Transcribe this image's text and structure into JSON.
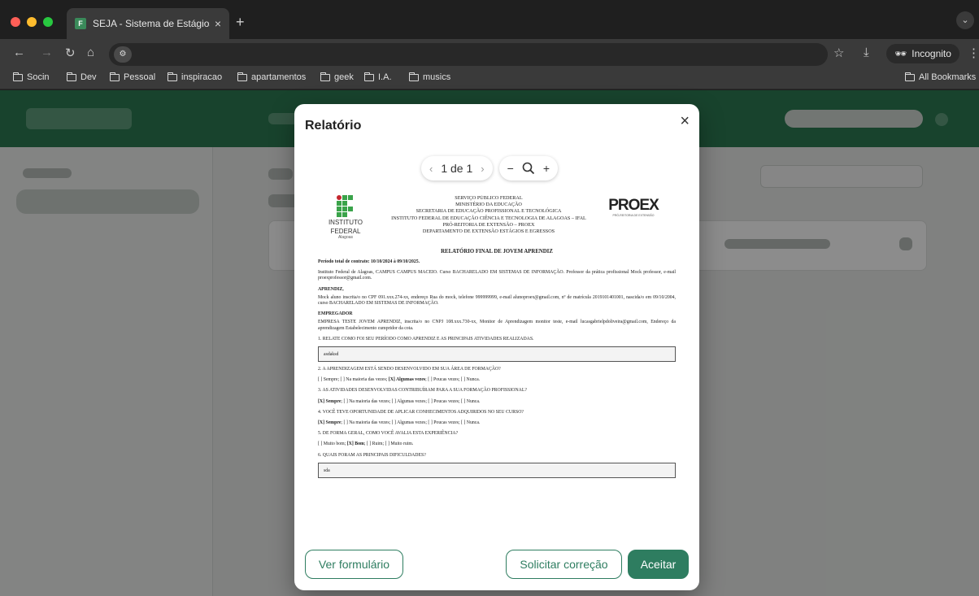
{
  "browser": {
    "tab_title": "SEJA - Sistema de Estágios e",
    "tab_favicon": "F",
    "new_tab": "+",
    "incognito_label": "Incognito",
    "bookmarks": [
      "Socin",
      "Dev",
      "Pessoal",
      "inspiracao",
      "apartamentos",
      "geek",
      "I.A.",
      "musics"
    ],
    "all_bookmarks": "All Bookmarks"
  },
  "modal": {
    "title": "Relatório",
    "close": "×",
    "pager": {
      "prev": "‹",
      "current": "1 de 1",
      "next": "›"
    },
    "zoom": {
      "minus": "−",
      "icon": "magnifier-icon",
      "plus": "+"
    },
    "buttons": {
      "form": "Ver formulário",
      "correction": "Solicitar correção",
      "accept": "Aceitar"
    }
  },
  "document": {
    "header_lines": [
      "SERVIÇO PÚBLICO FEDERAL",
      "MINISTÉRIO DA EDUCAÇÃO",
      "SECRETARIA DE EDUCAÇÃO PROFISSIONAL E TECNOLÓGICA",
      "INSTITUTO FEDERAL DE EDUCAÇÃO CIÊNCIA E TECNOLOGIA DE ALAGOAS – IFAL",
      "PRÓ-REITORIA DE EXTENSÃO – PROEX",
      "DEPARTAMENTO DE EXTENSÃO ESTÁGIOS E EGRESSOS"
    ],
    "if_logo": {
      "line1": "INSTITUTO",
      "line2": "FEDERAL",
      "line3": "Alagoas"
    },
    "proex_logo": {
      "text": "PROEX",
      "tagline": "PRÓ-REITORIA DE EXTENSÃO"
    },
    "title": "RELATÓRIO FINAL DE JOVEM APRENDIZ",
    "period": "Período total de contrato: 10/10/2024 à 09/10/2025.",
    "institution": "Instituto Federal de Alagoas, CAMPUS CAMPUS MACEIO. Curso BACHARELADO EM SISTEMAS DE INFORMAÇÃO. Professor da prática profissional Mock professor, e-mail proexprofessor@gmail.com.",
    "aprendiz_label": "APRENDIZ,",
    "aprendiz_text": "Mock aluno inscrita/o no CPF 091.xxx.274-xx, endereço Rua do mock, telefone 999999999, e-mail alunoproex@gmail.com, nº de matrícula 2019101401001, nascida/o em 09/10/2004, curso BACHARELADO EM SISTEMAS DE INFORMAÇÃO.",
    "empregador_label": "EMPREGADOR",
    "empregador_text": "EMPRESA TESTE JOVEM APRENDIZ, inscrita/o no CNPJ 108.xxx.730-xx, Monitor de Aprendizagem monitor teste, e-mail lucasgabrielpdoliveira@gmail.com, Endereço da aprendizagem Estabelecimento cumpridor da cota.",
    "q1": "1. RELATE COMO FOI SEU PERÍODO COMO APRENDIZ E AS PRINCIPAIS ATIVIDADES REALIZADAS.",
    "a1": "asdaksd",
    "q2": "2. A APRENDIZAGEM ESTÁ SENDO DESENVOLVIDO EM SUA ÁREA DE FORMAÇÃO?",
    "a2_pre": "[ ] Sempre; [ ] Na maioria das vezes; ",
    "a2_sel": "[X] Algumas vezes",
    "a2_post": "; [ ] Poucas vezes; [ ] Nunca.",
    "q3": "3. AS ATIVIDADES DESENVOLVIDAS CONTRIBUÍRAM PARA A SUA FORMAÇÃO PROFISSIONAL?",
    "a3_sel": "[X] Sempre",
    "a3_post": "; [ ] Na maioria das vezes; [ ] Algumas vezes; [ ] Poucas vezes; [ ] Nunca.",
    "q4": "4. VOCÊ TEVE OPORTUNIDADE DE APLICAR CONHECIMENTOS ADQUIRIDOS NO SEU CURSO?",
    "a4_sel": "[X] Sempre",
    "a4_post": "; [ ] Na maioria das vezes; [ ] Algumas vezes; [ ] Poucas vezes; [ ] Nunca.",
    "q5": "5. DE FORMA GERAL, COMO VOCÊ AVALIA ESTA EXPERIÊNCIA?",
    "a5_pre": "[ ] Muito bom; ",
    "a5_sel": "[X] Bom",
    "a5_post": "; [ ] Ruim; [ ] Muito ruim.",
    "q6": "6. QUAIS FORAM AS PRINCIPAIS DIFICULDADES?",
    "a6": "sda"
  },
  "colors": {
    "accent": "#2e7d60",
    "header_green": "#2d7a52"
  }
}
